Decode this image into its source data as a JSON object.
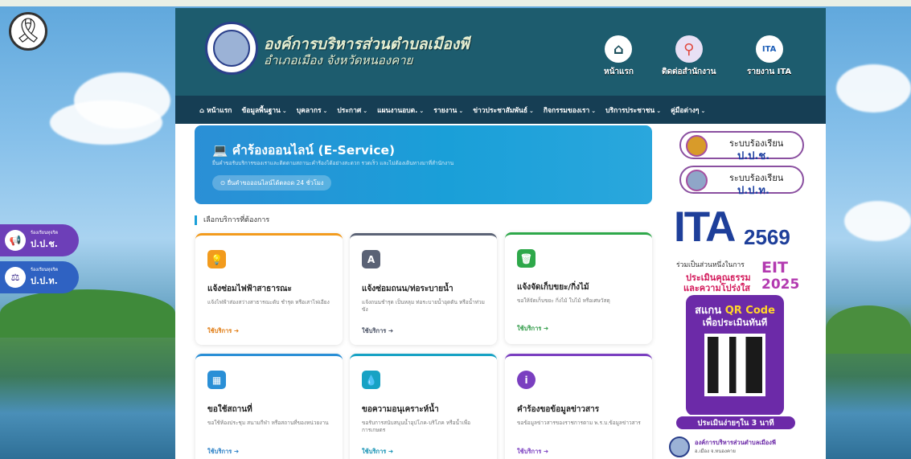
{
  "ribbon": {
    "icon": "mourning-ribbon-icon",
    "glyph": "🎗"
  },
  "header": {
    "title": "องค์การบริหารส่วนตำบลเมืองพี",
    "subtitle": "อำเภอเมือง จังหวัดหนองคาย",
    "buttons": [
      {
        "label": "หน้าแรก",
        "icon": "home-icon",
        "glyph": "⌂"
      },
      {
        "label": "ติดต่อสำนักงาน",
        "icon": "location-pin-icon",
        "glyph": "⚲"
      },
      {
        "label": "รายงาน ITA",
        "icon": "ita-icon",
        "glyph": "ITA"
      }
    ]
  },
  "nav": [
    {
      "label": "หน้าแรก",
      "icon": "home-icon",
      "glyph": "⌂",
      "caret": ""
    },
    {
      "label": "ข้อมูลพื้นฐาน",
      "caret": "⌄"
    },
    {
      "label": "บุคลากร",
      "caret": "⌄"
    },
    {
      "label": "ประกาศ",
      "caret": "⌄"
    },
    {
      "label": "แผนงานอบต.",
      "caret": "⌄"
    },
    {
      "label": "รายงาน",
      "caret": "⌄"
    },
    {
      "label": "ข่าวประชาสัมพันธ์",
      "caret": "⌄"
    },
    {
      "label": "กิจกรรมของเรา",
      "caret": "⌄"
    },
    {
      "label": "บริการประชาชน",
      "caret": "⌄"
    },
    {
      "label": "คู่มือต่างๆ",
      "caret": "⌄"
    }
  ],
  "hero": {
    "icon": "laptop-icon",
    "glyph": "💻",
    "title": "คำร้องออนไลน์ (E-Service)",
    "description": "ยื่นคำขอรับบริการของเราและติดตามสถานะคำร้องได้อย่างสะดวก รวดเร็ว และไม่ต้องเดินทางมาที่สำนักงาน",
    "pill": "ยื่นคำขอออนไลน์ได้ตลอด 24 ชั่วโมง",
    "pill_icon": "clock-icon",
    "pill_glyph": "⊙"
  },
  "section_title": "เลือกบริการที่ต้องการ",
  "cards": [
    {
      "title": "แจ้งซ่อมไฟฟ้าสาธารณะ",
      "desc": "แจ้งไฟฟ้าส่องสว่างสาธารณะดับ ชำรุด หรือเสาไฟเอียง",
      "link": "ใช้บริการ ➜",
      "icon": "lightbulb-icon",
      "glyph": "💡",
      "color": "#f29b1d"
    },
    {
      "title": "แจ้งซ่อมถนน/ท่อระบายน้ำ",
      "desc": "แจ้งถนนชำรุด เป็นหลุม ท่อระบายน้ำอุดตัน หรือน้ำท่วมขัง",
      "link": "ใช้บริการ ➜",
      "icon": "road-icon",
      "glyph": "A",
      "color": "#5a6275"
    },
    {
      "title": "แจ้งจัดเก็บขยะ/กิ่งไม้",
      "desc": "ขอให้จัดเก็บขยะ กิ่งไม้ ใบไม้ หรือเศษวัสดุ",
      "link": "ใช้บริการ ➜",
      "icon": "trash-icon",
      "glyph": "🗑",
      "color": "#2ea84a"
    },
    {
      "title": "ขอใช้สถานที่",
      "desc": "ขอใช้ห้องประชุม สนามกีฬา หรือสถานที่ของหน่วยงาน",
      "link": "ใช้บริการ ➜",
      "icon": "building-icon",
      "glyph": "▦",
      "color": "#2a8fd6"
    },
    {
      "title": "ขอความอนุเคราะห์น้ำ",
      "desc": "ขอรับการสนับสนุนน้ำอุปโภค-บริโภค หรือน้ำเพื่อการเกษตร",
      "link": "ใช้บริการ ➜",
      "icon": "water-drop-icon",
      "glyph": "💧",
      "color": "#17a2c4"
    },
    {
      "title": "คำร้องขอข้อมูลข่าวสาร",
      "desc": "ขอข้อมูลข่าวสารของราชการตาม พ.ร.บ.ข้อมูลข่าวสาร",
      "link": "ใช้บริการ ➜",
      "icon": "info-icon",
      "glyph": "i",
      "color": "#7a3fc0"
    }
  ],
  "side": {
    "pill1": {
      "t1": "ระบบร้องเรียน",
      "t2": "ป.ป.ช."
    },
    "pill2": {
      "t1": "ระบบร้องเรียน",
      "t2": "ป.ป.ท."
    },
    "ita": {
      "logo": "ITA",
      "year": "2569",
      "join": "ร่วมเป็นส่วนหนึ่งในการ",
      "eit": "EIT",
      "line2": "ประเมินคุณธรรม",
      "line3": "และความโปร่งใส",
      "eit_year": "2025",
      "scan_pre": "สแกน ",
      "scan_qr": "QR Code",
      "scan_line2": "เพื่อประเมินทันที",
      "bar": "ประเมินง่ายๆใน 3 นาที"
    },
    "bottom": {
      "name": "องค์การบริหารส่วนตำบลเมืองพี",
      "sub": "อ.เมือง จ.หนองคาย"
    }
  },
  "left_tabs": [
    {
      "small": "ร้องเรียนทุจริต",
      "big": "ป.ป.ช.",
      "icon": "megaphone-icon",
      "glyph": "📢",
      "color": "#6d3fb8"
    },
    {
      "small": "ร้องเรียนทุจริต",
      "big": "ป.ป.ท.",
      "icon": "gavel-icon",
      "glyph": "⚖",
      "color": "#2f62c2"
    }
  ]
}
